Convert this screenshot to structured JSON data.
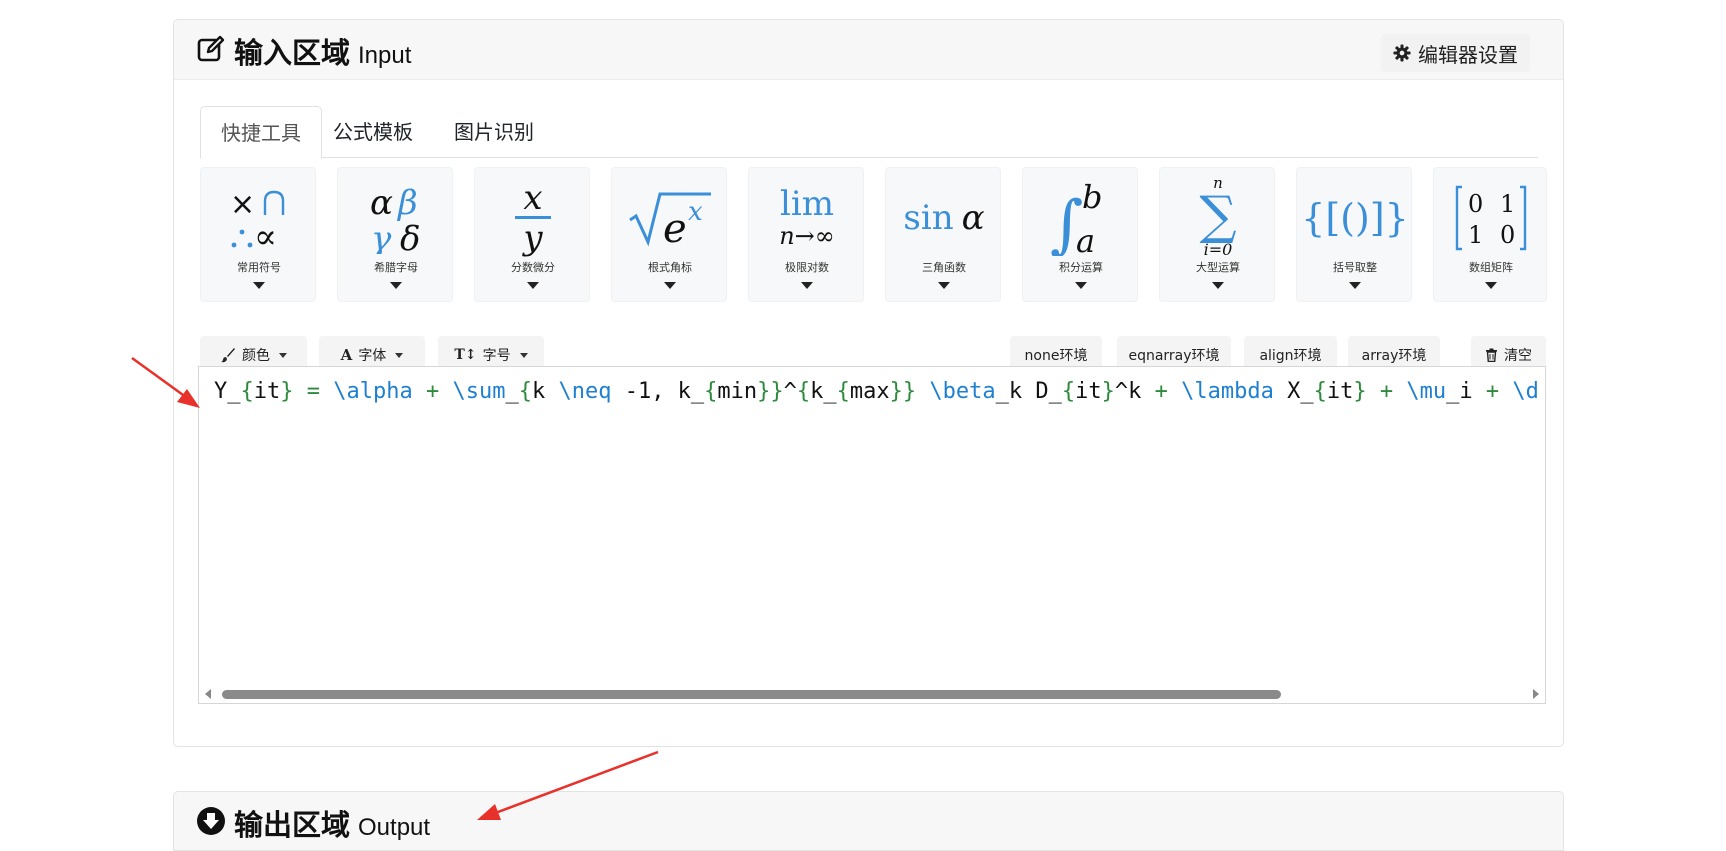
{
  "input_section": {
    "title_cn": "输入区域",
    "title_en": "Input",
    "settings_label": "编辑器设置"
  },
  "tabs": [
    {
      "label": "快捷工具",
      "active": true
    },
    {
      "label": "公式模板",
      "active": false
    },
    {
      "label": "图片识别",
      "active": false
    }
  ],
  "tools": [
    {
      "label": "常用符号",
      "icon": "common-symbols-icon"
    },
    {
      "label": "希腊字母",
      "icon": "greek-letters-icon"
    },
    {
      "label": "分数微分",
      "icon": "fraction-icon"
    },
    {
      "label": "根式角标",
      "icon": "radical-icon"
    },
    {
      "label": "极限对数",
      "icon": "limit-icon"
    },
    {
      "label": "三角函数",
      "icon": "trig-icon"
    },
    {
      "label": "积分运算",
      "icon": "integral-icon"
    },
    {
      "label": "大型运算",
      "icon": "summation-icon"
    },
    {
      "label": "括号取整",
      "icon": "brackets-icon"
    },
    {
      "label": "数组矩阵",
      "icon": "matrix-icon"
    }
  ],
  "tool_glyphs": {
    "fraction_num": "x",
    "fraction_den": "y",
    "radical_base": "e",
    "radical_exp": "x",
    "lim_word": "lim",
    "lim_sub": "n→∞",
    "sin_word": "sin",
    "sin_arg": "α",
    "int_upper": "b",
    "int_lower": "a",
    "sum_upper": "n",
    "sum_lower": "i=0",
    "brackets": "{[()]}",
    "matrix_r1c1": "0",
    "matrix_r1c2": "1",
    "matrix_r2c1": "1",
    "matrix_r2c2": "0"
  },
  "toolbar": {
    "color_label": "颜色",
    "font_label": "字体",
    "size_label": "字号",
    "env_none": "none环境",
    "env_eqnarray": "eqnarray环境",
    "env_align": "align环境",
    "env_array": "array环境",
    "clear_label": "清空"
  },
  "editor": {
    "content": "Y_{it} = \\alpha + \\sum_{k \\neq -1, k_{min}}^{k_{max}} \\beta_k D_{it}^k + \\lambda X_{it} + \\mu_i + \\d",
    "scroll_fraction": 0.79
  },
  "output_section": {
    "title_cn": "输出区域",
    "title_en": "Output"
  },
  "colors": {
    "latex_command": "#1f7fd1",
    "latex_brace": "#2e8b3e",
    "icon_blue": "#3b8fd9",
    "annotation_arrow": "#e8312a"
  }
}
